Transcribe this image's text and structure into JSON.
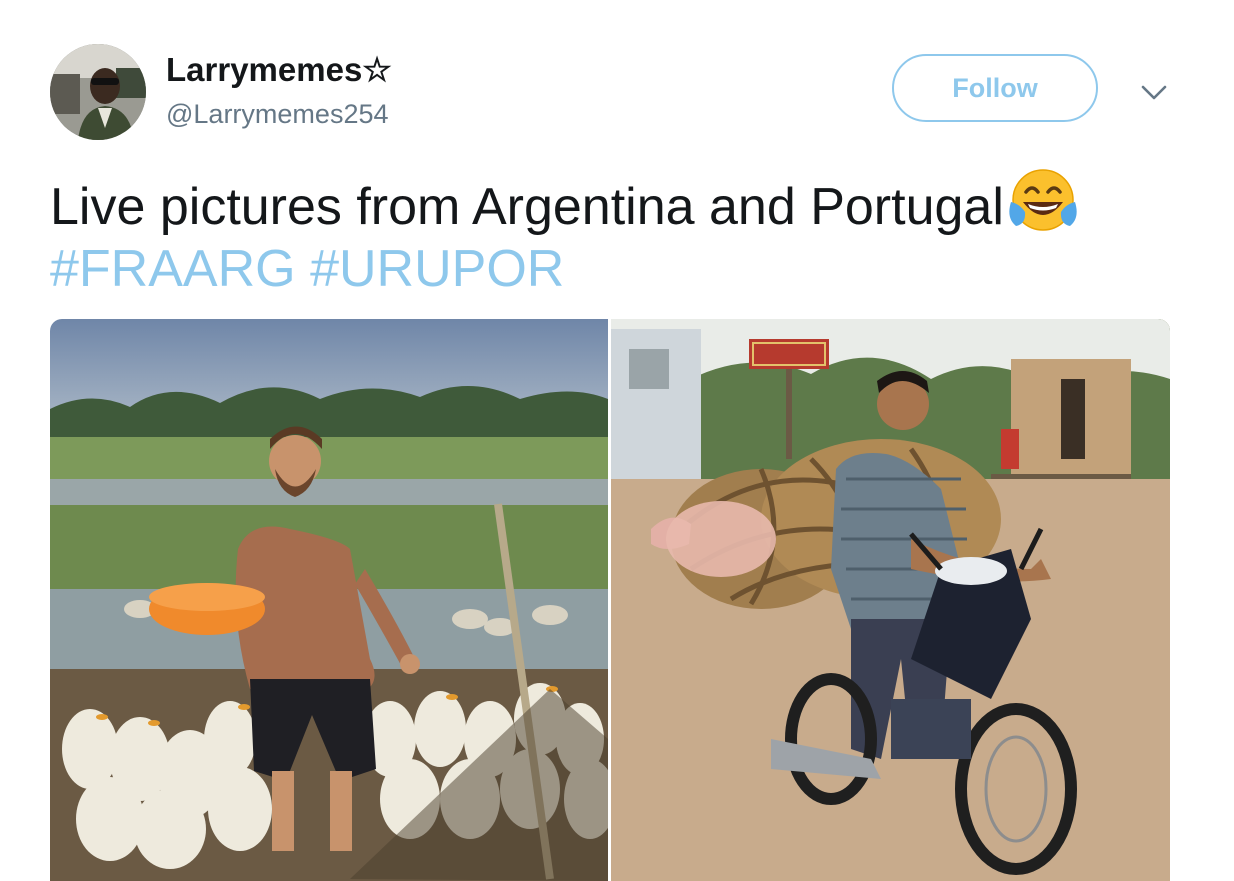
{
  "tweet": {
    "author": {
      "display_name": "Larrymemes☆",
      "handle": "@Larrymemes254"
    },
    "follow_label": "Follow",
    "text": "Live pictures from Argentina and Portugal",
    "emoji": "face-with-tears-of-joy",
    "hashtags": [
      "#FRAARG",
      "#URUPOR"
    ],
    "media": [
      {
        "description": "man holding orange basin among white ducks in a field"
      },
      {
        "description": "man riding motorcycle carrying a pig in a bamboo basket"
      }
    ]
  },
  "colors": {
    "accent": "#8ec8ec",
    "text": "#14171a",
    "secondary_text": "#657786"
  }
}
